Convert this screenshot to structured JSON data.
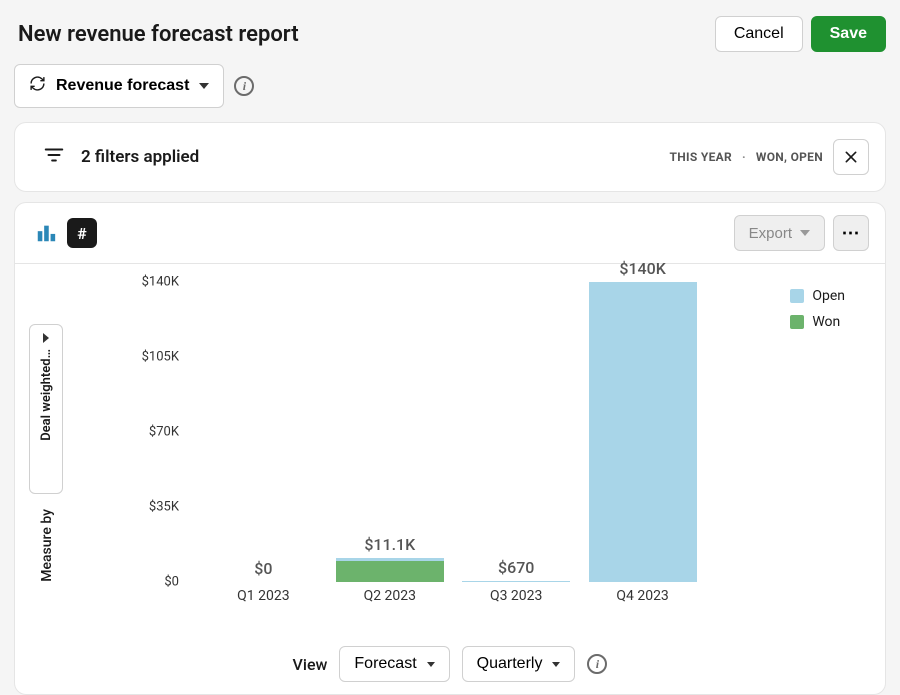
{
  "header": {
    "title": "New revenue forecast report",
    "cancel": "Cancel",
    "save": "Save"
  },
  "toolbar": {
    "report_type": "Revenue forecast"
  },
  "filters": {
    "text": "2 filters applied",
    "period": "THIS YEAR",
    "status": "WON, OPEN"
  },
  "panel": {
    "export": "Export",
    "side_tab": "Deal weighted…",
    "measure_by": "Measure by"
  },
  "footer": {
    "view": "View",
    "forecast": "Forecast",
    "quarterly": "Quarterly"
  },
  "legend": {
    "open": "Open",
    "won": "Won"
  },
  "chart_data": {
    "type": "bar",
    "title": "",
    "xlabel": "",
    "ylabel": "",
    "ylim": [
      0,
      140000
    ],
    "y_ticks": [
      "$0",
      "$35K",
      "$70K",
      "$105K",
      "$140K"
    ],
    "categories": [
      "Q1 2023",
      "Q2 2023",
      "Q3 2023",
      "Q4 2023"
    ],
    "series": [
      {
        "name": "Won",
        "color": "#6cb36c",
        "values": [
          0,
          10000,
          0,
          0
        ]
      },
      {
        "name": "Open",
        "color": "#a8d5e8",
        "values": [
          0,
          1100,
          670,
          140000
        ]
      }
    ],
    "totals_labels": [
      "$0",
      "$11.1K",
      "$670",
      "$140K"
    ],
    "totals_values": [
      0,
      11100,
      670,
      140000
    ]
  }
}
